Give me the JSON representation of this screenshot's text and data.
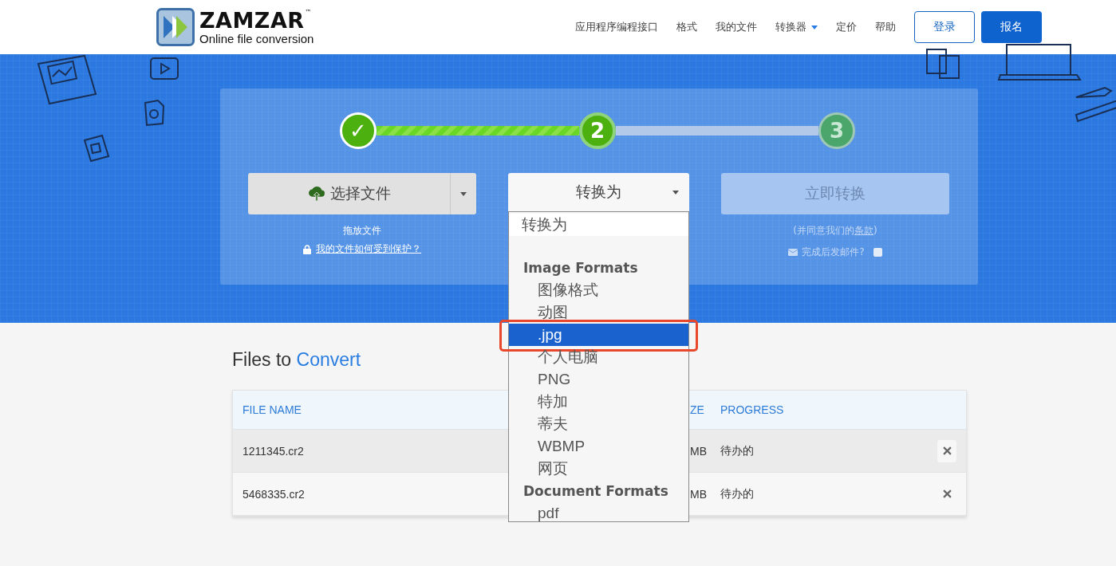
{
  "header": {
    "logo": {
      "name": "ZAMZAR",
      "trademark": "™",
      "tagline": "Online file conversion"
    },
    "nav": [
      {
        "label": "应用程序编程接口",
        "dropdown": false
      },
      {
        "label": "格式",
        "dropdown": false
      },
      {
        "label": "我的文件",
        "dropdown": false
      },
      {
        "label": "转换器",
        "dropdown": true
      },
      {
        "label": "定价",
        "dropdown": false
      },
      {
        "label": "帮助",
        "dropdown": false
      }
    ],
    "login": "登录",
    "signup": "报名"
  },
  "steps": [
    {
      "label": "✓",
      "done": true,
      "current": false
    },
    {
      "label": "2",
      "done": false,
      "current": true
    },
    {
      "label": "3",
      "done": false,
      "current": false
    }
  ],
  "choose_file": {
    "label": "选择文件",
    "hint": "拖放文件",
    "protect_link": "我的文件如何受到保护？"
  },
  "convert_to": {
    "label": "转换为",
    "options": [
      {
        "label": "转换为",
        "selected": false
      }
    ],
    "groups": [
      {
        "label": "Image Formats",
        "options": [
          {
            "label": "图像格式",
            "selected": false
          },
          {
            "label": "动图",
            "selected": false
          },
          {
            "label": ".jpg",
            "selected": true
          },
          {
            "label": "个人电脑",
            "selected": false
          },
          {
            "label": "PNG",
            "selected": false
          },
          {
            "label": "特加",
            "selected": false
          },
          {
            "label": "蒂夫",
            "selected": false
          },
          {
            "label": "WBMP",
            "selected": false
          },
          {
            "label": "网页",
            "selected": false
          }
        ]
      },
      {
        "label": "Document Formats",
        "options": [
          {
            "label": "pdf",
            "selected": false
          }
        ]
      }
    ]
  },
  "convert_now": {
    "label": "立即转换",
    "disabled": true,
    "terms_before": "(并同意我们的",
    "terms_link": "条款",
    "terms_after": ")",
    "email_label": "完成后发邮件?",
    "email_checked": false
  },
  "files": {
    "title_plain": "Files to",
    "title_accent": "Convert",
    "columns": [
      {
        "label": "FILE NAME"
      },
      {
        "label": "ZE"
      },
      {
        "label": "PROGRESS"
      }
    ],
    "rows": [
      {
        "name": "1211345.cr2",
        "size": "MB",
        "progress": "待办的",
        "highlighted": true
      },
      {
        "name": "5468335.cr2",
        "size": "MB",
        "progress": "待办的",
        "highlighted": false
      }
    ]
  }
}
